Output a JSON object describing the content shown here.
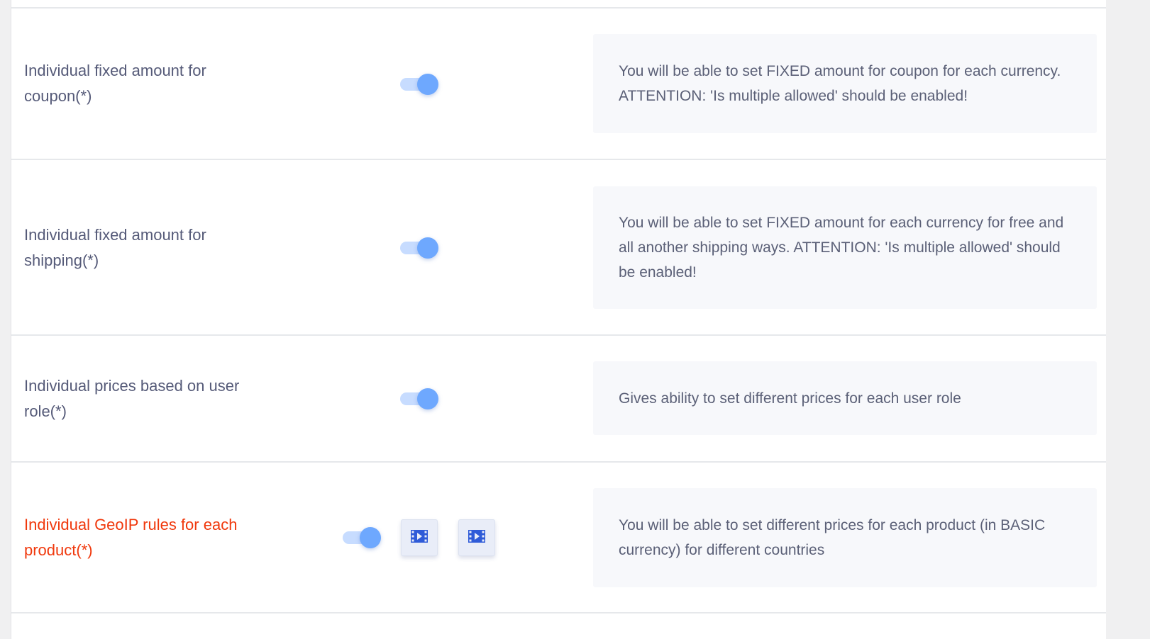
{
  "settings": [
    {
      "label": "Individual fixed amount for coupon(*)",
      "enabled": true,
      "description": "You will be able to set FIXED amount for coupon for each currency. ATTENTION: 'Is multiple allowed' should be enabled!"
    },
    {
      "label": "Individual fixed amount for shipping(*)",
      "enabled": true,
      "description": "You will be able to set FIXED amount for each currency for free and all another shipping ways. ATTENTION: 'Is multiple allowed' should be enabled!"
    },
    {
      "label": "Individual prices based on user role(*)",
      "enabled": true,
      "description": "Gives ability to set different prices for each user role"
    },
    {
      "label": "Individual GeoIP rules for each product(*)",
      "enabled": true,
      "highlight_color": "#f0380c",
      "video_buttons": [
        "video-icon",
        "video-icon"
      ],
      "description": "You will be able to set different prices for each product (in BASIC currency) for different countries"
    }
  ],
  "colors": {
    "label": "#555a78",
    "accent": "#6ea8fe",
    "track": "#c7dcff",
    "highlight": "#f0380c",
    "desc_bg": "#f7f8fb"
  }
}
